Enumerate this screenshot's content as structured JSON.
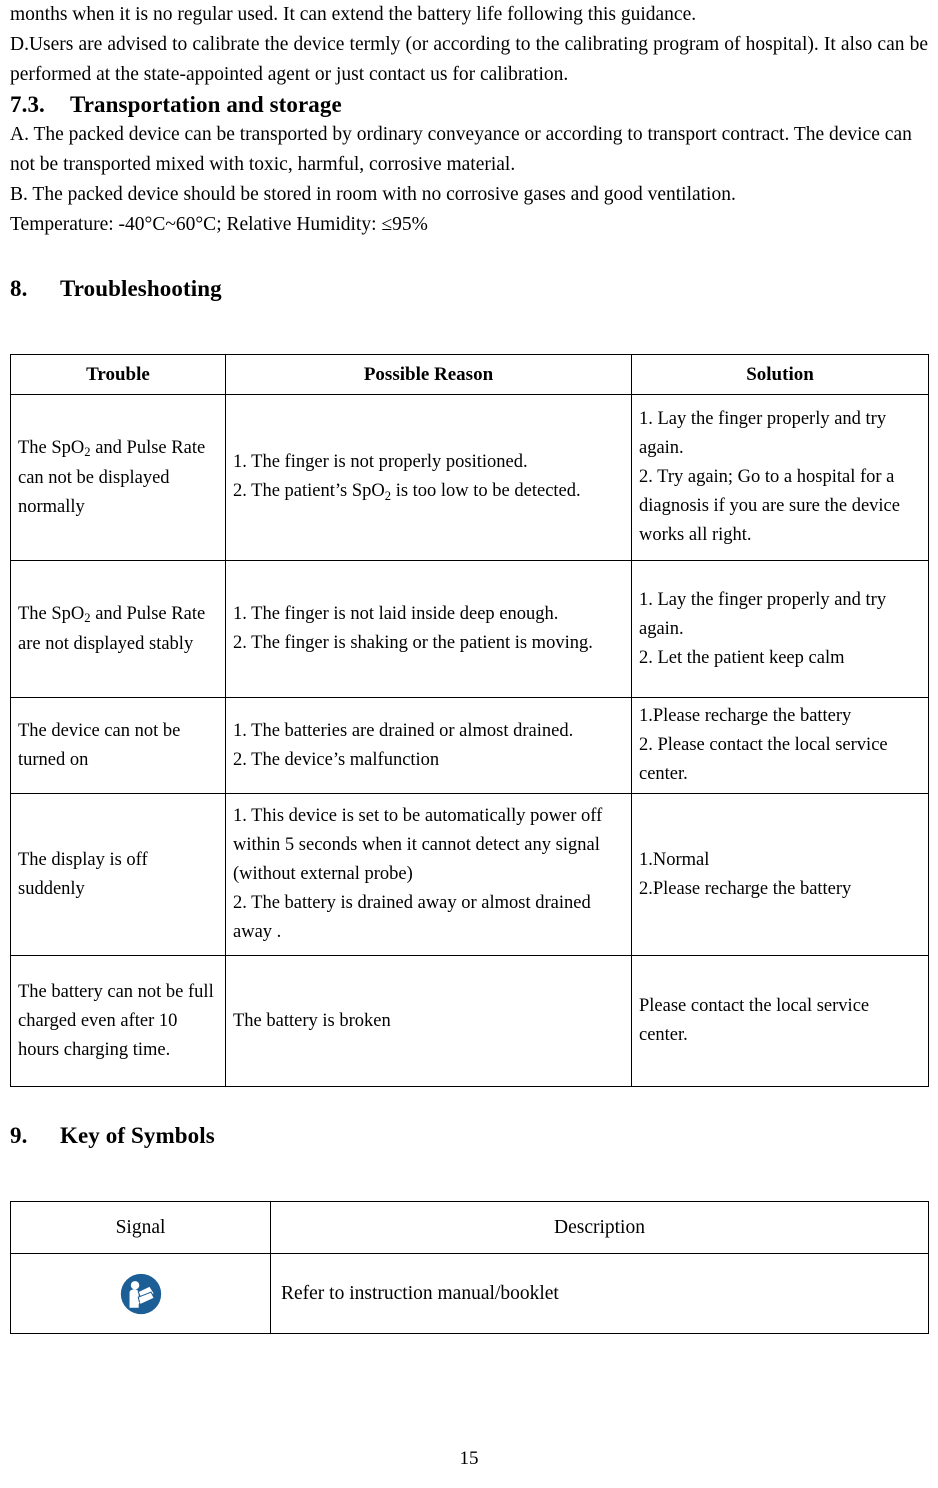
{
  "document": {
    "page_number": "15",
    "accent_color": "#1c5e96"
  },
  "top_text": {
    "line1": "months when it is no regular used. It can extend the battery life following this guidance.",
    "line2": "D.Users are advised to calibrate the device termly (or according to the calibrating program of hospital). It also can be performed at the state-appointed agent or just contact us for calibration."
  },
  "section_7_3": {
    "number": "7.3.",
    "title": "Transportation and storage",
    "para_a": "A. The packed device can be transported by ordinary conveyance or according to transport contract. The device can not be transported mixed with toxic, harmful, corrosive material.",
    "para_b": "B. The packed device should be stored in room with no corrosive gases and good ventilation.",
    "para_b2": "Temperature: -40°C~60°C; Relative Humidity: ≤95%"
  },
  "section_8": {
    "number": "8.",
    "title": "Troubleshooting",
    "table": {
      "headers": [
        "Trouble",
        "Possible Reason",
        "Solution"
      ],
      "rows": [
        {
          "trouble_prefix": "The SpO",
          "trouble_sub": "2",
          "trouble_suffix": " and Pulse Rate can not be displayed normally",
          "reason_lines": [
            "1. The finger is not properly positioned.",
            "2. The patient’s SpO2 is too low to be detected."
          ],
          "solution_lines": [
            "1. Lay the finger properly and try again.",
            "2. Try again; Go to a hospital for a diagnosis if you are sure the device works all right."
          ]
        },
        {
          "trouble_prefix": "The SpO",
          "trouble_sub": "2",
          "trouble_suffix": " and Pulse Rate are not displayed stably",
          "reason_lines": [
            "1. The finger is not laid inside deep enough.",
            "2. The finger is shaking or the patient is moving."
          ],
          "solution_lines": [
            "1. Lay the finger properly and try again.",
            "2. Let the patient keep calm"
          ]
        },
        {
          "trouble_prefix": "The device can not be turned on",
          "trouble_sub": "",
          "trouble_suffix": "",
          "reason_lines": [
            "1. The batteries are drained or almost drained.",
            "2. The device’s malfunction"
          ],
          "solution_lines": [
            "1.Please recharge the battery",
            "2. Please contact the local service center."
          ]
        },
        {
          "trouble_prefix": "The display is off suddenly",
          "trouble_sub": "",
          "trouble_suffix": "",
          "reason_lines": [
            "1. This device is set to be automatically power off within 5 seconds when it cannot detect any signal (without external probe)",
            "2. The battery is drained away or almost drained away ."
          ],
          "solution_lines": [
            "1.Normal",
            "2.Please recharge the battery"
          ]
        },
        {
          "trouble_prefix": "The battery can not be full charged even after 10 hours charging time.",
          "trouble_sub": "",
          "trouble_suffix": "",
          "reason_lines": [
            " The battery is broken"
          ],
          "solution_lines": [
            "Please contact the local service center."
          ]
        }
      ]
    }
  },
  "section_9": {
    "number": "9.",
    "title": "Key of Symbols",
    "table": {
      "headers": [
        "Signal",
        "Description"
      ],
      "rows": [
        {
          "icon": "refer-to-manual-icon",
          "description": "Refer to instruction manual/booklet"
        }
      ]
    }
  }
}
